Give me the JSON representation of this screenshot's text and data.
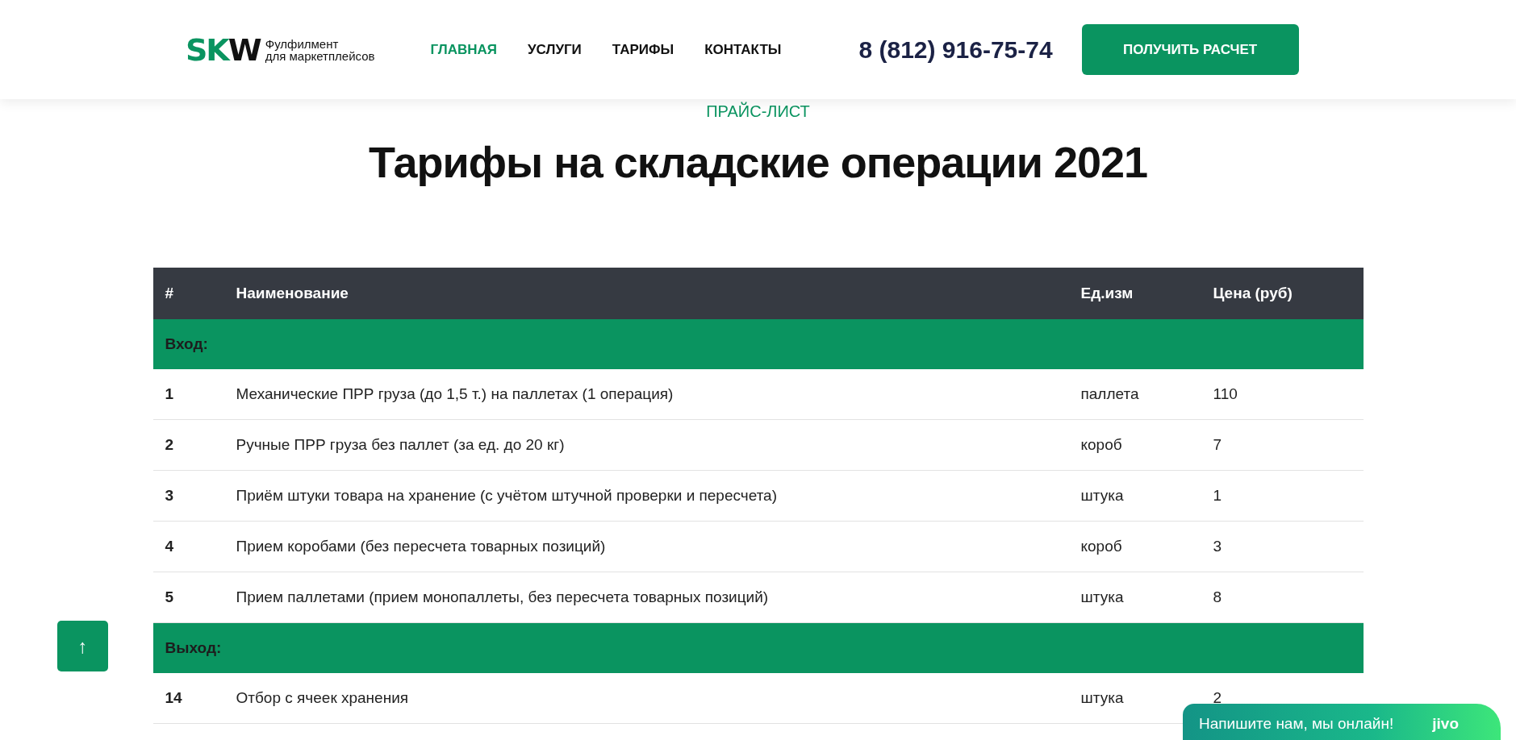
{
  "header": {
    "logo": {
      "mark_start": "SK",
      "mark_end": "W",
      "tagline": "Фулфилмент\nдля маркетплейсов"
    },
    "nav": [
      {
        "label": "ГЛАВНАЯ",
        "selected": true
      },
      {
        "label": "УСЛУГИ",
        "selected": false
      },
      {
        "label": "ТАРИФЫ",
        "selected": false
      },
      {
        "label": "КОНТАКТЫ",
        "selected": false
      }
    ],
    "phone": "8 (812) 916-75-74",
    "cta": "ПОЛУЧИТЬ РАСЧЕТ"
  },
  "eyebrow": "ПРАЙС-ЛИСТ",
  "title": "Тарифы на складские операции 2021",
  "table": {
    "columns": [
      "#",
      "Наименование",
      "Ед.изм",
      "Цена (руб)"
    ],
    "rows": [
      {
        "kind": "section",
        "label": "Вход:"
      },
      {
        "kind": "item",
        "cells": [
          "1",
          "Механические ПРР груза (до 1,5 т.) на паллетах (1 операция)",
          "паллета",
          "110"
        ]
      },
      {
        "kind": "item",
        "cells": [
          "2",
          "Ручные ПРР груза без паллет (за ед. до 20 кг)",
          "короб",
          "7"
        ]
      },
      {
        "kind": "item",
        "cells": [
          "3",
          "Приём штуки товара на хранение (с учётом штучной проверки и пересчета)",
          "штука",
          "1"
        ]
      },
      {
        "kind": "item",
        "cells": [
          "4",
          "Прием коробами (без пересчета товарных позиций)",
          "короб",
          "3"
        ]
      },
      {
        "kind": "item",
        "cells": [
          "5",
          "Прием паллетами (прием монопаллеты, без пересчета товарных позиций)",
          "штука",
          "8"
        ]
      },
      {
        "kind": "section",
        "label": "Выход:"
      },
      {
        "kind": "item",
        "cells": [
          "14",
          "Отбор с ячеек хранения",
          "штука",
          "2"
        ]
      }
    ]
  },
  "scroll_top": "↑",
  "chat": {
    "text": "Напишите нам, мы онлайн!",
    "brand": "jivo"
  }
}
